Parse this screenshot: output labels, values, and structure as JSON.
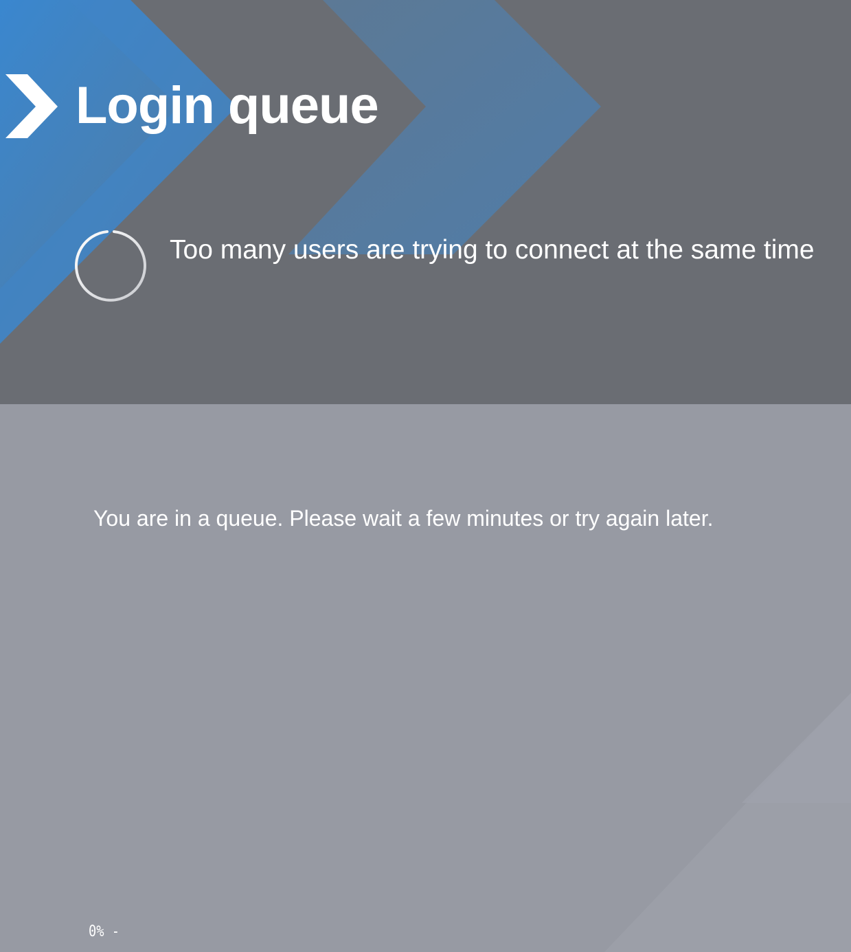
{
  "header": {
    "title": "Login queue",
    "message": "Too many users are trying to connect at the same time",
    "logo_icon": "chevron-right-icon",
    "spinner_icon": "loading-spinner-icon"
  },
  "main": {
    "queue_message": "You are in a queue. Please wait a few minutes or try again later.",
    "progress_label": "0% -",
    "progress_value": 0
  },
  "colors": {
    "header_bg": "#6a6d73",
    "content_bg": "#979aa3",
    "accent_blue": "#3d85c6",
    "text": "#ffffff"
  }
}
